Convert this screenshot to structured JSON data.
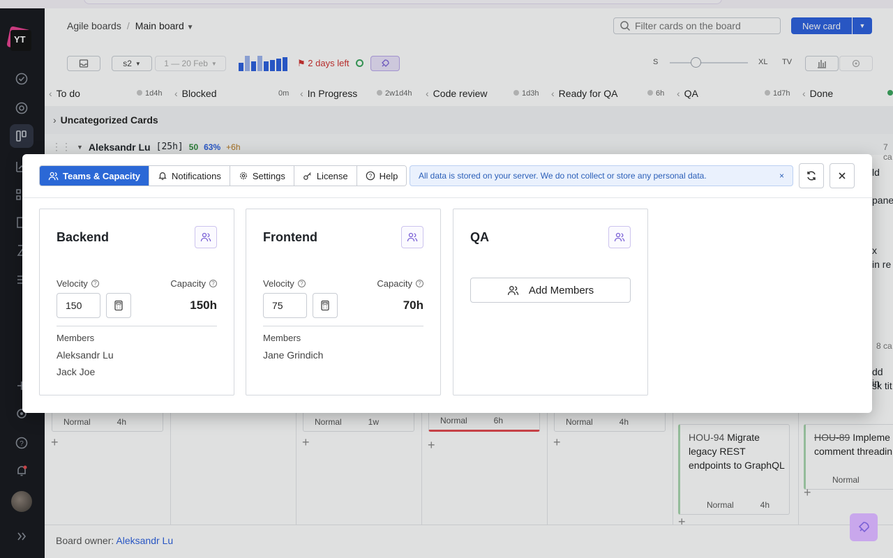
{
  "header": {
    "breadcrumb_root": "Agile boards",
    "board_name": "Main board",
    "filter_placeholder": "Filter cards on the board",
    "new_card": "New card"
  },
  "toolbar": {
    "sprint": "s2",
    "sprint_dates": "1 — 20 Feb",
    "days_left": "2 days left",
    "size_s": "S",
    "size_xl": "XL",
    "size_tv": "TV"
  },
  "columns": [
    {
      "name": "To do",
      "estimate": "1d4h"
    },
    {
      "name": "Blocked",
      "estimate": "0m"
    },
    {
      "name": "In Progress",
      "estimate": "2w1d4h"
    },
    {
      "name": "Code review",
      "estimate": "1d3h"
    },
    {
      "name": "Ready for QA",
      "estimate": "6h"
    },
    {
      "name": "QA",
      "estimate": "1d7h"
    },
    {
      "name": "Done",
      "estimate": ""
    }
  ],
  "swimlanes": {
    "uncategorized": "Uncategorized Cards",
    "lane_name": "Aleksandr Lu",
    "lane_estimate": "[25h]",
    "lane_points": "50",
    "lane_percent": "63%",
    "lane_extra": "+6h",
    "lane_count": "7 ca",
    "lane_count2": "8 ca"
  },
  "cards": {
    "priority": "Normal",
    "est_todo": "4h",
    "est_inprog": "1w",
    "est_codereview": "6h",
    "est_readyqa": "4h",
    "qa_card_id": "HOU-94",
    "qa_card_title": "Migrate legacy REST endpoints to GraphQL",
    "qa_card_est": "4h",
    "done_card_id": "HOU-89",
    "done_card_title": "Impleme comment threadin",
    "edge_1": "ld",
    "edge_2": "panel",
    "edge_3": "x",
    "edge_4": "in re",
    "edge_5": "dd in",
    "edge_6": "sk tit"
  },
  "footer": {
    "label": "Board owner:",
    "owner": "Aleksandr Lu"
  },
  "modal": {
    "tabs": [
      "Teams & Capacity",
      "Notifications",
      "Settings",
      "License",
      "Help"
    ],
    "notice": "All data is stored on your server. We do not collect or store any personal data.",
    "notice_close": "×",
    "velocity_label": "Velocity",
    "capacity_label": "Capacity",
    "members_label": "Members",
    "add_members": "Add Members",
    "teams": [
      {
        "name": "Backend",
        "velocity": "150",
        "capacity": "150h",
        "members": [
          "Aleksandr Lu",
          "Jack Joe"
        ]
      },
      {
        "name": "Frontend",
        "velocity": "75",
        "capacity": "70h",
        "members": [
          "Jane Grindich"
        ]
      },
      {
        "name": "QA"
      }
    ]
  },
  "colors": {
    "accent": "#2b68d6",
    "team_icon": "#7b61d6",
    "sidebar": "#15171c",
    "days_left": "#d0302f"
  }
}
